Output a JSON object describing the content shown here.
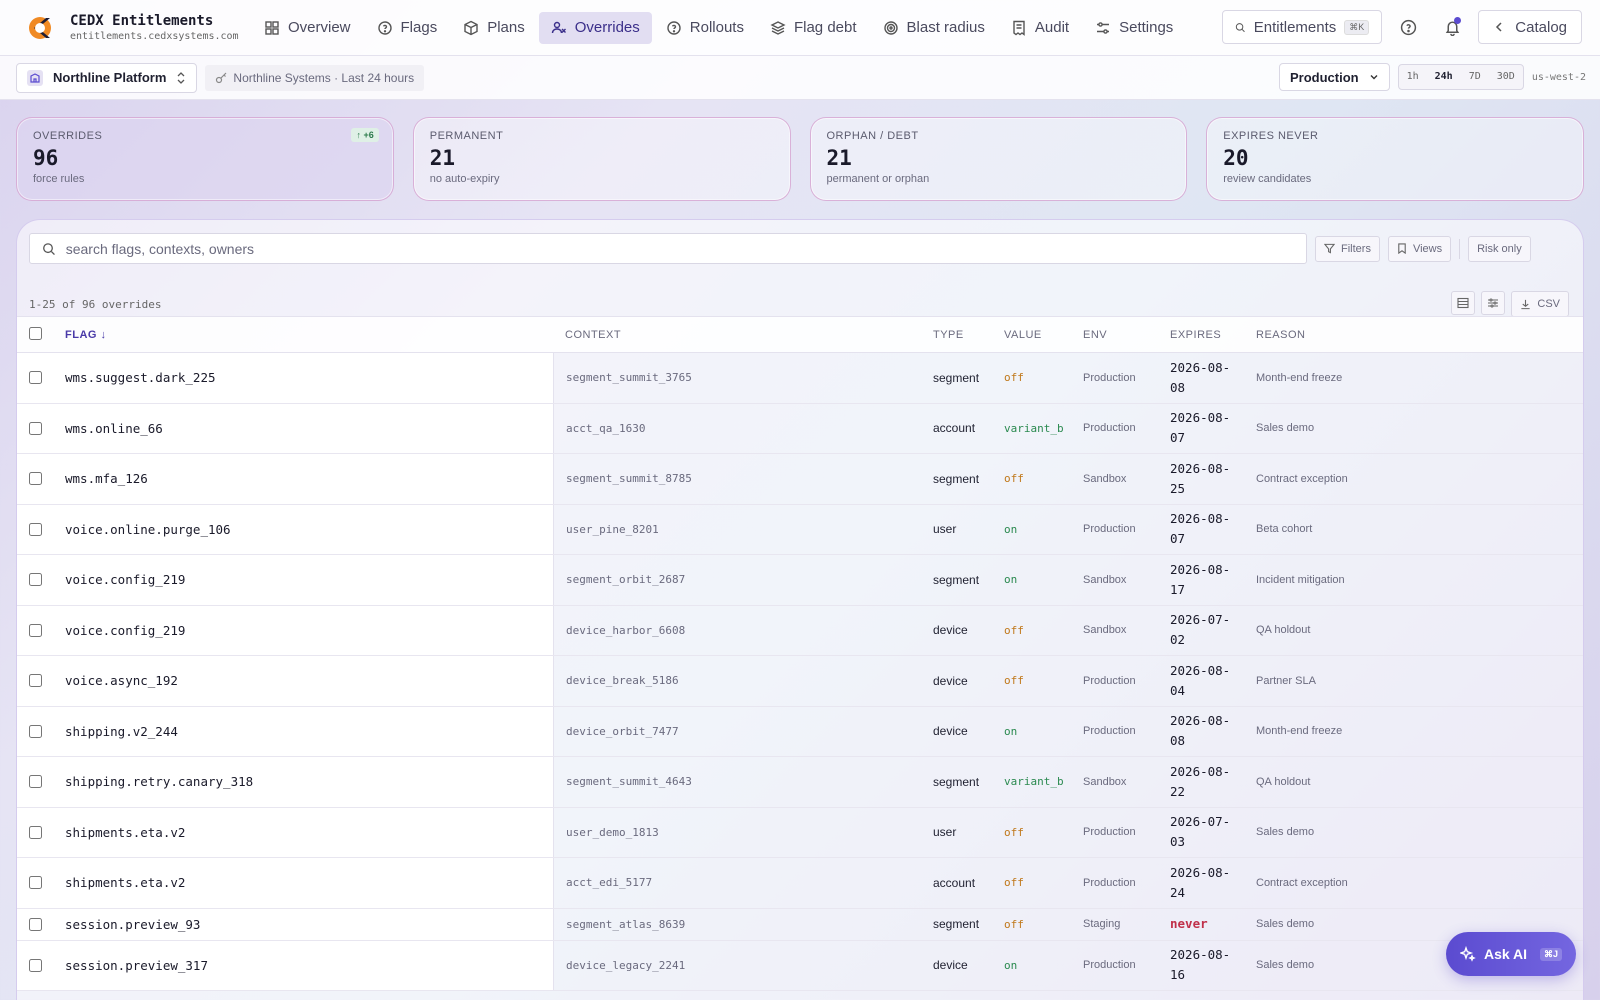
{
  "brand": {
    "name": "CEDX Entitlements",
    "domain": "entitlements.cedxsystems.com"
  },
  "nav": [
    {
      "label": "Overview",
      "icon": "grid-icon"
    },
    {
      "label": "Flags",
      "icon": "help-circle-icon"
    },
    {
      "label": "Plans",
      "icon": "box-icon"
    },
    {
      "label": "Overrides",
      "icon": "user-override-icon",
      "active": true
    },
    {
      "label": "Rollouts",
      "icon": "help-circle-icon"
    },
    {
      "label": "Flag debt",
      "icon": "layers-icon"
    },
    {
      "label": "Blast radius",
      "icon": "target-icon"
    },
    {
      "label": "Audit",
      "icon": "receipt-icon"
    },
    {
      "label": "Settings",
      "icon": "sliders-icon"
    }
  ],
  "top_right": {
    "search_label": "Entitlements",
    "search_kbd": "⌘K",
    "catalog_label": "Catalog"
  },
  "subbar": {
    "workspace": "Northline Platform",
    "context_chip": "Northline Systems · Last 24 hours",
    "environment": "Production",
    "time_ranges": [
      "1h",
      "24h",
      "7D",
      "30D"
    ],
    "time_selected": "24h",
    "region": "us-west-2"
  },
  "kpis": [
    {
      "label": "Overrides",
      "value": "96",
      "sub": "force rules",
      "delta": "↑ +6"
    },
    {
      "label": "Permanent",
      "value": "21",
      "sub": "no auto-expiry"
    },
    {
      "label": "Orphan / Debt",
      "value": "21",
      "sub": "permanent or orphan"
    },
    {
      "label": "Expires never",
      "value": "20",
      "sub": "review candidates"
    }
  ],
  "toolbar": {
    "search_placeholder": "search flags, contexts, owners",
    "filters": "Filters",
    "views": "Views",
    "risk_only": "Risk only",
    "count": "1-25 of 96 overrides",
    "csv": "CSV"
  },
  "table": {
    "headers": {
      "flag": "Flag",
      "context": "Context",
      "type": "Type",
      "value": "Value",
      "env": "Env",
      "expires": "Expires",
      "reason": "Reason"
    },
    "rows": [
      {
        "flag": "wms.suggest.dark_225",
        "context": "segment_summit_3765",
        "type": "segment",
        "value": "off",
        "env": "Production",
        "expires_a": "2026-08-",
        "expires_b": "08",
        "reason": "Month-end freeze"
      },
      {
        "flag": "wms.online_66",
        "context": "acct_qa_1630",
        "type": "account",
        "value": "variant_b",
        "env": "Production",
        "expires_a": "2026-08-",
        "expires_b": "07",
        "reason": "Sales demo"
      },
      {
        "flag": "wms.mfa_126",
        "context": "segment_summit_8785",
        "type": "segment",
        "value": "off",
        "env": "Sandbox",
        "expires_a": "2026-08-",
        "expires_b": "25",
        "reason": "Contract exception"
      },
      {
        "flag": "voice.online.purge_106",
        "context": "user_pine_8201",
        "type": "user",
        "value": "on",
        "env": "Production",
        "expires_a": "2026-08-",
        "expires_b": "07",
        "reason": "Beta cohort"
      },
      {
        "flag": "voice.config_219",
        "context": "segment_orbit_2687",
        "type": "segment",
        "value": "on",
        "env": "Sandbox",
        "expires_a": "2026-08-",
        "expires_b": "17",
        "reason": "Incident mitigation"
      },
      {
        "flag": "voice.config_219",
        "context": "device_harbor_6608",
        "type": "device",
        "value": "off",
        "env": "Sandbox",
        "expires_a": "2026-07-",
        "expires_b": "02",
        "reason": "QA holdout"
      },
      {
        "flag": "voice.async_192",
        "context": "device_break_5186",
        "type": "device",
        "value": "off",
        "env": "Production",
        "expires_a": "2026-08-",
        "expires_b": "04",
        "reason": "Partner SLA"
      },
      {
        "flag": "shipping.v2_244",
        "context": "device_orbit_7477",
        "type": "device",
        "value": "on",
        "env": "Production",
        "expires_a": "2026-08-",
        "expires_b": "08",
        "reason": "Month-end freeze"
      },
      {
        "flag": "shipping.retry.canary_318",
        "context": "segment_summit_4643",
        "type": "segment",
        "value": "variant_b",
        "env": "Sandbox",
        "expires_a": "2026-08-",
        "expires_b": "22",
        "reason": "QA holdout"
      },
      {
        "flag": "shipments.eta.v2",
        "context": "user_demo_1813",
        "type": "user",
        "value": "off",
        "env": "Production",
        "expires_a": "2026-07-",
        "expires_b": "03",
        "reason": "Sales demo"
      },
      {
        "flag": "shipments.eta.v2",
        "context": "acct_edi_5177",
        "type": "account",
        "value": "off",
        "env": "Production",
        "expires_a": "2026-08-",
        "expires_b": "24",
        "reason": "Contract exception"
      },
      {
        "flag": "session.preview_93",
        "context": "segment_atlas_8639",
        "type": "segment",
        "value": "off",
        "env": "Staging",
        "expires_a": "never",
        "expires_b": "",
        "reason": "Sales demo"
      },
      {
        "flag": "session.preview_317",
        "context": "device_legacy_2241",
        "type": "device",
        "value": "on",
        "env": "Production",
        "expires_a": "2026-08-",
        "expires_b": "16",
        "reason": "Sales demo"
      }
    ]
  },
  "ask_ai": {
    "label": "Ask AI",
    "kbd": "⌘J"
  }
}
